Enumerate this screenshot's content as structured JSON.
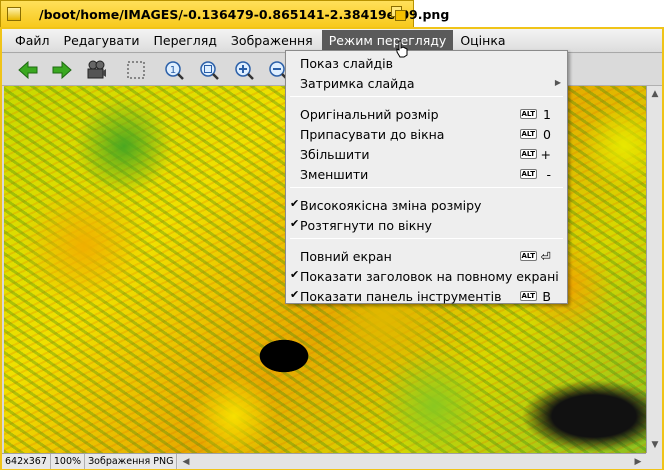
{
  "window": {
    "title": "/boot/home/IMAGES/-0.136479-0.865141-2.38419e-09.png"
  },
  "menubar": {
    "items": [
      {
        "label": "Файл"
      },
      {
        "label": "Редагувати"
      },
      {
        "label": "Перегляд"
      },
      {
        "label": "Зображення"
      },
      {
        "label": "Режим перегляду"
      },
      {
        "label": "Оцінка"
      }
    ],
    "active_index": 4
  },
  "toolbar": {
    "icons": [
      "back-arrow-icon",
      "forward-arrow-icon",
      "slideshow-projector-icon",
      "selection-icon",
      "original-size-icon",
      "fit-window-icon",
      "zoom-in-icon",
      "zoom-out-icon"
    ]
  },
  "dropdown": {
    "items": [
      {
        "label": "Показ слайдів",
        "checked": false,
        "shortcut": "",
        "alt": false,
        "submenu": false
      },
      {
        "label": "Затримка слайда",
        "checked": false,
        "shortcut": "",
        "alt": false,
        "submenu": true
      },
      {
        "label": "Оригінальний розмір",
        "checked": false,
        "shortcut": "1",
        "alt": true,
        "submenu": false
      },
      {
        "label": "Припасувати до вікна",
        "checked": false,
        "shortcut": "0",
        "alt": true,
        "submenu": false
      },
      {
        "label": "Збільшити",
        "checked": false,
        "shortcut": "+",
        "alt": true,
        "submenu": false
      },
      {
        "label": "Зменшити",
        "checked": false,
        "shortcut": "-",
        "alt": true,
        "submenu": false
      },
      {
        "label": "Високоякісна зміна розміру",
        "checked": true,
        "shortcut": "",
        "alt": false,
        "submenu": false
      },
      {
        "label": "Розтягнути по вікну",
        "checked": true,
        "shortcut": "",
        "alt": false,
        "submenu": false
      },
      {
        "label": "Повний екран",
        "checked": false,
        "shortcut": "⏎",
        "alt": true,
        "submenu": false
      },
      {
        "label": "Показати заголовок на повному екрані",
        "checked": true,
        "shortcut": "",
        "alt": false,
        "submenu": false
      },
      {
        "label": "Показати панель інструментів",
        "checked": true,
        "shortcut": "B",
        "alt": true,
        "submenu": false
      }
    ],
    "alt_key_label": "ALT",
    "check_glyph": "✔"
  },
  "status": {
    "dimensions": "642x367",
    "zoom": "100%",
    "type": "Зображення PNG"
  },
  "colors": {
    "tab": "#f7c81a",
    "menu_active": "#5a5a5a",
    "back_arrow": "#3aa820"
  }
}
